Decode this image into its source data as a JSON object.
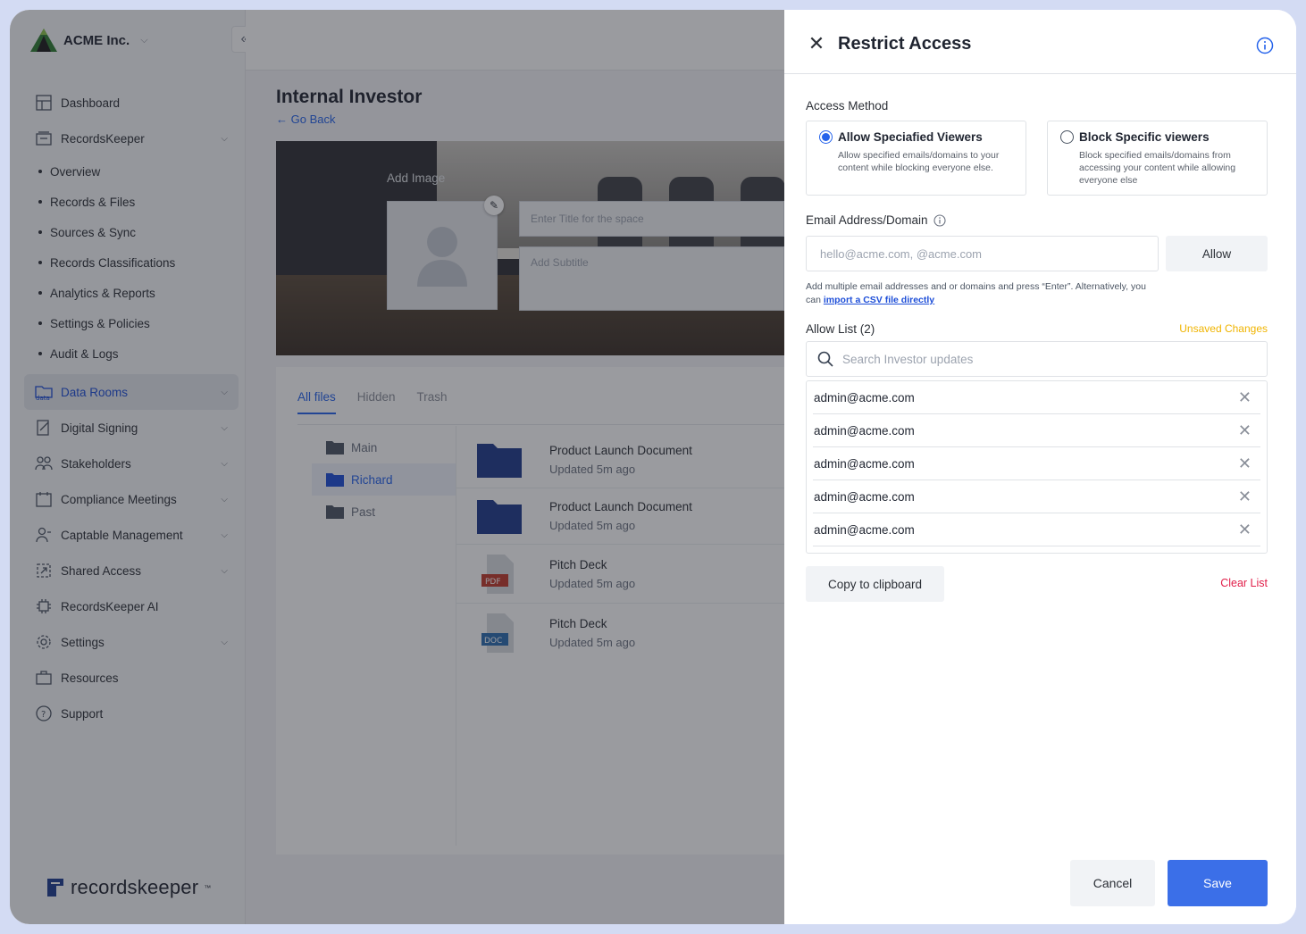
{
  "org": {
    "name": "ACME Inc."
  },
  "sidebar": {
    "items": [
      {
        "label": "Dashboard",
        "icon": "dashboard-icon"
      },
      {
        "label": "RecordsKeeper",
        "icon": "recordskeeper-icon"
      },
      {
        "label": "Overview"
      },
      {
        "label": "Records & Files"
      },
      {
        "label": "Sources & Sync"
      },
      {
        "label": "Records Classifications"
      },
      {
        "label": "Analytics & Reports"
      },
      {
        "label": "Settings & Policies"
      },
      {
        "label": "Audit & Logs"
      },
      {
        "label": "Data Rooms",
        "icon": "data-rooms-icon"
      },
      {
        "label": "Digital Signing",
        "icon": "signing-icon"
      },
      {
        "label": "Stakeholders",
        "icon": "stakeholders-icon"
      },
      {
        "label": "Compliance Meetings",
        "icon": "meetings-icon"
      },
      {
        "label": "Captable Management",
        "icon": "captable-icon"
      },
      {
        "label": "Shared Access",
        "icon": "shared-access-icon"
      },
      {
        "label": "RecordsKeeper AI",
        "icon": "ai-chip-icon"
      },
      {
        "label": "Settings",
        "icon": "gear-icon"
      },
      {
        "label": "Resources",
        "icon": "briefcase-icon"
      },
      {
        "label": "Support",
        "icon": "help-icon"
      }
    ],
    "footer_brand": "recordskeeper",
    "footer_tm": "™"
  },
  "main": {
    "title": "Internal Investor",
    "go_back": "Go Back",
    "add_image": "Add Image",
    "title_placeholder": "Enter Title for the space",
    "subtitle_placeholder": "Add Subtitle",
    "tabs": [
      "All files",
      "Hidden",
      "Trash"
    ],
    "folders": [
      "Main",
      "Richard",
      "Past"
    ],
    "files": [
      {
        "name": "Product Launch Document",
        "meta": "Updated 5m ago",
        "type": "folder"
      },
      {
        "name": "Product Launch Document",
        "meta": "Updated 5m ago",
        "type": "folder"
      },
      {
        "name": "Pitch Deck",
        "meta": "Updated 5m ago",
        "type": "PDF"
      },
      {
        "name": "Pitch Deck",
        "meta": "Updated 5m ago",
        "type": "DOC"
      }
    ]
  },
  "drawer": {
    "title": "Restrict Access",
    "access_method_label": "Access Method",
    "options": [
      {
        "title": "Allow Speciafied Viewers",
        "desc": "Allow specified emails/domains to your content while blocking everyone else.",
        "selected": true
      },
      {
        "title": "Block Specific viewers",
        "desc": "Block specified emails/domains from accessing your content while allowing everyone else",
        "selected": false
      }
    ],
    "email_label": "Email Address/Domain",
    "email_placeholder": "hello@acme.com, @acme.com",
    "allow_button": "Allow",
    "hint_text": "Add multiple email addresses and or domains and press “Enter”. Alternatively, you can ",
    "hint_link": "import a CSV file directly",
    "allow_list_label": "Allow List (2)",
    "unsaved": "Unsaved Changes",
    "search_placeholder": "Search Investor updates",
    "allow_list": [
      "admin@acme.com",
      "admin@acme.com",
      "admin@acme.com",
      "admin@acme.com",
      "admin@acme.com"
    ],
    "copy_button": "Copy to clipboard",
    "clear_list": "Clear List",
    "cancel": "Cancel",
    "save": "Save"
  },
  "colors": {
    "accent": "#3b6fe8",
    "warning": "#f0b400",
    "danger": "#e11d48"
  }
}
